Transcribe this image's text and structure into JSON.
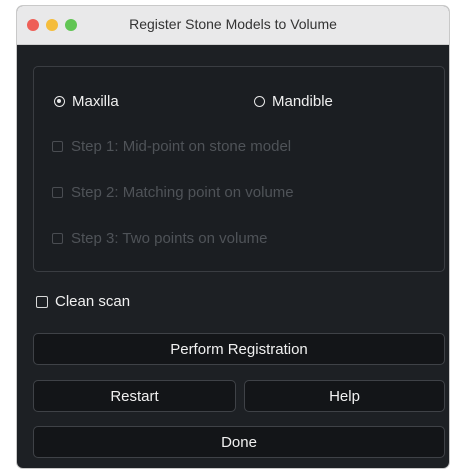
{
  "window": {
    "title": "Register Stone Models to Volume"
  },
  "jaw": {
    "maxilla_label": "Maxilla",
    "mandible_label": "Mandible",
    "selected": "Maxilla"
  },
  "steps": [
    {
      "label": "Step 1: Mid-point on stone model",
      "checked": false,
      "enabled": false
    },
    {
      "label": "Step 2: Matching point on volume",
      "checked": false,
      "enabled": false
    },
    {
      "label": "Step 3: Two points on volume",
      "checked": false,
      "enabled": false
    }
  ],
  "clean_scan": {
    "label": "Clean scan",
    "checked": false
  },
  "buttons": {
    "perform": "Perform Registration",
    "restart": "Restart",
    "help": "Help",
    "done": "Done"
  },
  "colors": {
    "window_bg": "#1d2024",
    "close": "#ee5f57",
    "minimize": "#f5bd3b",
    "maximize": "#61c554"
  }
}
